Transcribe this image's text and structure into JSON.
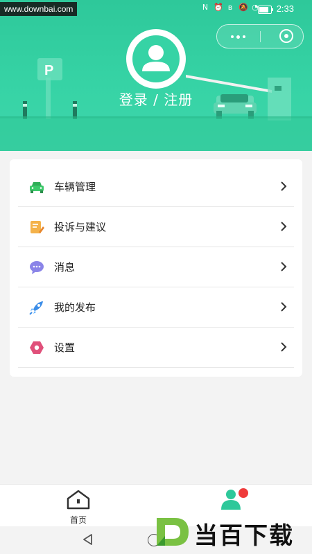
{
  "watermark": {
    "site": "www.downbai.com",
    "brand": "当百下载"
  },
  "status_bar": {
    "time": "2:33",
    "battery_percent": 70
  },
  "header": {
    "login_label": "登录 / 注册"
  },
  "mini_program": {
    "more_icon": "more-dots-icon",
    "close_icon": "target-close-icon"
  },
  "colors": {
    "primary": "#36d3a5",
    "card_bg": "#ffffff",
    "page_bg": "#f3f3f3"
  },
  "menu": [
    {
      "label": "车辆管理",
      "icon": "car-icon"
    },
    {
      "label": "投诉与建议",
      "icon": "note-edit-icon"
    },
    {
      "label": "消息",
      "icon": "chat-bubble-icon"
    },
    {
      "label": "我的发布",
      "icon": "rocket-icon"
    },
    {
      "label": "设置",
      "icon": "hexagon-settings-icon"
    }
  ],
  "tabbar": {
    "home_label": "首页",
    "mine_icon": "users-icon"
  }
}
